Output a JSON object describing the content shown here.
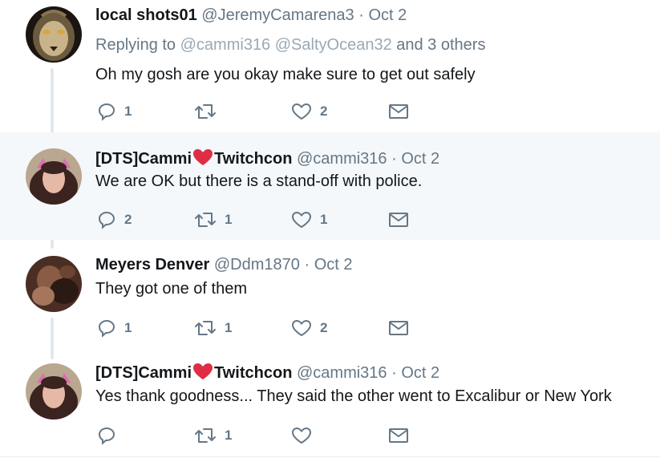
{
  "tweets": [
    {
      "name": "local shots01",
      "handle": "@JeremyCamarena3",
      "sep": "·",
      "date": "Oct 2",
      "replying": {
        "prefix": "Replying to",
        "users": [
          "@cammi316",
          "@SaltyOcean32"
        ],
        "suffix": "and 3 others"
      },
      "text": "Oh my gosh are you okay make sure to get out safely",
      "replies": "1",
      "retweets": "",
      "likes": "2"
    },
    {
      "name_pre": "[DTS]Cammi",
      "name_post": "Twitchcon",
      "handle": "@cammi316",
      "sep": "·",
      "date": "Oct 2",
      "text": "We are OK but there is a stand-off with police.",
      "replies": "2",
      "retweets": "1",
      "likes": "1"
    },
    {
      "name": "Meyers Denver",
      "handle": "@Ddm1870",
      "sep": "·",
      "date": "Oct 2",
      "text": "They got one of them",
      "replies": "1",
      "retweets": "1",
      "likes": "2"
    },
    {
      "name_pre": "[DTS]Cammi",
      "name_post": "Twitchcon",
      "handle": "@cammi316",
      "sep": "·",
      "date": "Oct 2",
      "text": "Yes thank goodness... They said the other went to Excalibur or New York",
      "replies": "",
      "retweets": "1",
      "likes": ""
    }
  ],
  "icons": {
    "reply": "reply-icon",
    "retweet": "retweet-icon",
    "like": "heart-icon",
    "dm": "envelope-icon",
    "heart_emoji": "red-heart-emoji-icon"
  },
  "colors": {
    "highlight_bg": "#f5f8fa",
    "secondary_text": "#657786",
    "heart_red": "#e0245e",
    "thread_line": "#e1e8ed"
  }
}
